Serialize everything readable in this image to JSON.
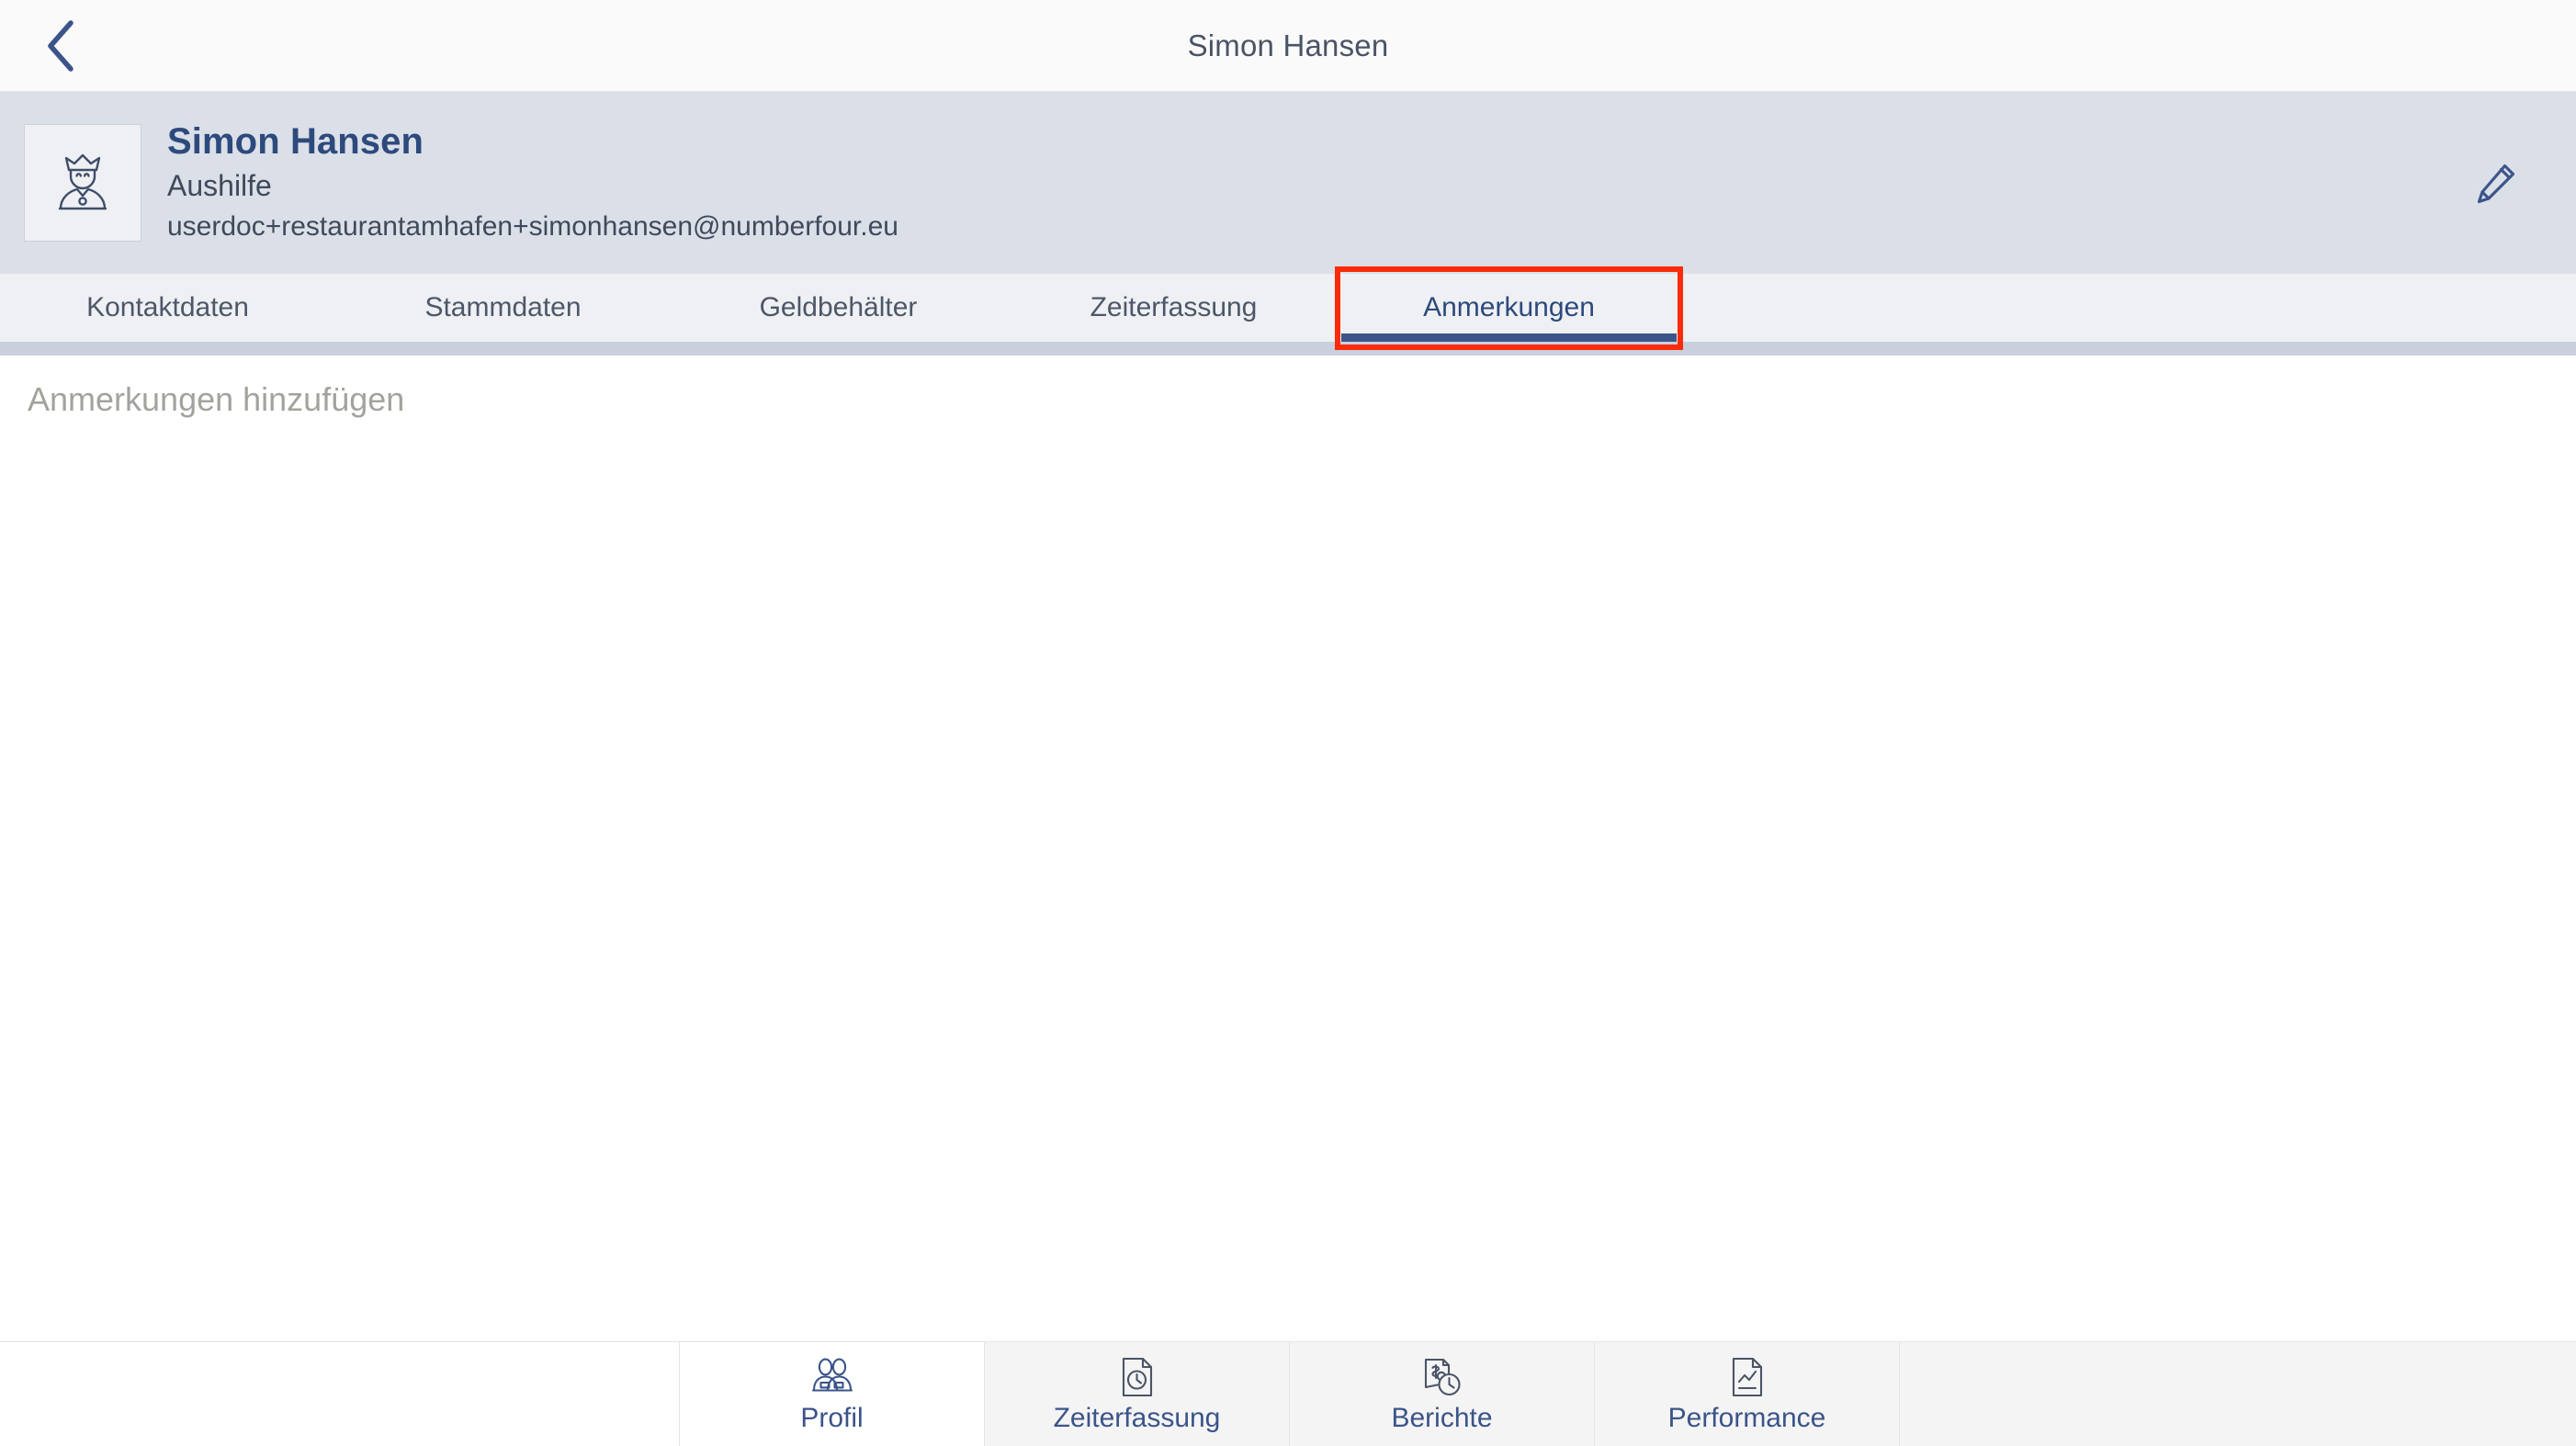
{
  "titlebar": {
    "back_icon": "chevron-left-icon",
    "title": "Simon Hansen"
  },
  "profile": {
    "avatar_icon": "king-person-avatar-icon",
    "name": "Simon Hansen",
    "role": "Aushilfe",
    "email": "userdoc+restaurantamhafen+simonhansen@numberfour.eu",
    "edit_icon": "pencil-edit-icon"
  },
  "tabs": [
    {
      "label": "Kontaktdaten",
      "active": false
    },
    {
      "label": "Stammdaten",
      "active": false
    },
    {
      "label": "Geldbehälter",
      "active": false
    },
    {
      "label": "Zeiterfassung",
      "active": false
    },
    {
      "label": "Anmerkungen",
      "active": true
    }
  ],
  "content": {
    "notes_value": "",
    "notes_placeholder": "Anmerkungen hinzufügen"
  },
  "bottom_nav": [
    {
      "label": "Profil",
      "icon": "two-people-icon",
      "active": true
    },
    {
      "label": "Zeiterfassung",
      "icon": "document-clock-icon",
      "active": false
    },
    {
      "label": "Berichte",
      "icon": "receipt-money-clock-icon",
      "active": false
    },
    {
      "label": "Performance",
      "icon": "document-chart-icon",
      "active": false
    }
  ],
  "colors": {
    "accent_blue": "#3b5489",
    "name_blue": "#2d4a7c",
    "highlight_red": "#fa2b08",
    "band_bg": "#dbdfe8",
    "tabbar_bg": "#eef0f4",
    "divider_grey": "#c9cfdb",
    "nav_bg": "#f4f4f5",
    "placeholder_grey": "#a3a39e"
  }
}
